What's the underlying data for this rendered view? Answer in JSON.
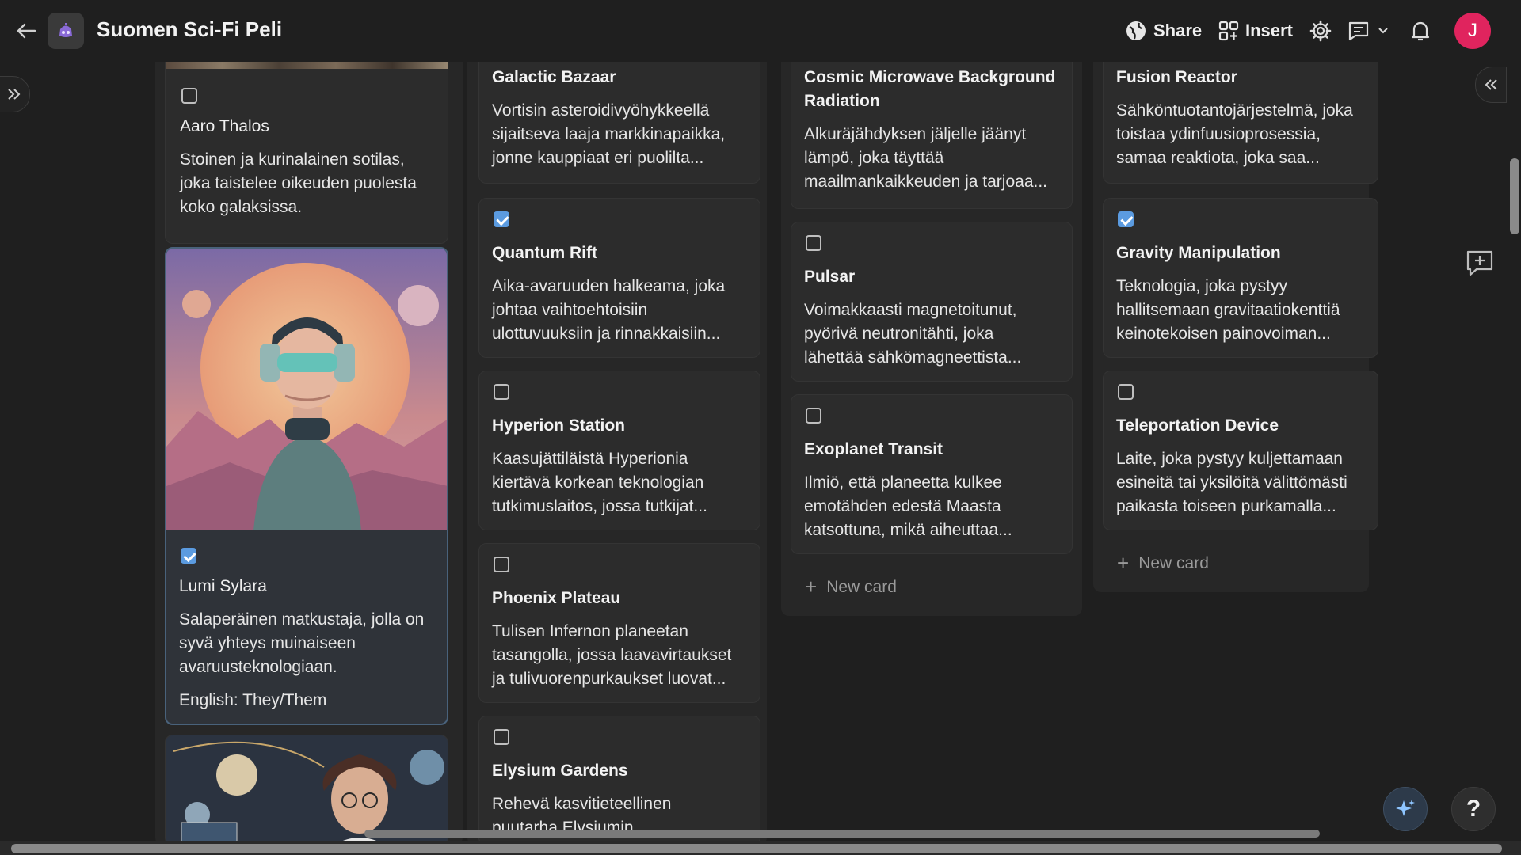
{
  "header": {
    "title": "Suomen Sci-Fi Peli",
    "share_label": "Share",
    "insert_label": "Insert",
    "avatar_initial": "J"
  },
  "colors": {
    "accent": "#5b9be0",
    "avatar": "#e0245e",
    "background": "#1f1f1f"
  },
  "columns": [
    {
      "cards": [
        {
          "checked": false,
          "name": "Aaro Thalos",
          "text": [
            "Stoinen ja kurinalainen sotilas,",
            "joka taistelee oikeuden puolesta",
            "koko galaksissa."
          ]
        },
        {
          "checked": true,
          "image": "astronaut-woman-illustration",
          "name": "Lumi Sylara",
          "text": [
            "Salaperäinen matkustaja, jolla on",
            "syvä yhteys muinaiseen",
            "avaruusteknologiaan."
          ],
          "extra": "English: They/Them"
        },
        {
          "image": "scientist-woman-illustration"
        }
      ]
    },
    {
      "cards": [
        {
          "title": "Galactic Bazaar",
          "text": [
            "Vortisin asteroidivyöhykkeellä",
            "sijaitseva laaja markkinapaikka,",
            "jonne kauppiaat eri puolilta..."
          ]
        },
        {
          "checked": true,
          "title": "Quantum Rift",
          "text": [
            "Aika-avaruuden halkeama, joka",
            "johtaa vaihtoehtoisiin",
            "ulottuvuuksiin ja rinnakkaisiin..."
          ]
        },
        {
          "checked": false,
          "title": "Hyperion Station",
          "text": [
            "Kaasujättiläistä Hyperionia",
            "kiertävä korkean teknologian",
            "tutkimuslaitos, jossa tutkijat..."
          ]
        },
        {
          "checked": false,
          "title": "Phoenix Plateau",
          "text": [
            "Tulisen Infernon planeetan",
            "tasangolla, jossa laavavirtaukset",
            "ja tulivuorenpurkaukset luovat..."
          ]
        },
        {
          "checked": false,
          "title": "Elysium Gardens",
          "text": [
            "Rehevä kasvitieteellinen",
            "puutarha Elysiumin"
          ]
        }
      ]
    },
    {
      "cards": [
        {
          "title": [
            "Cosmic Microwave Background",
            "Radiation"
          ],
          "text": [
            "Alkuräjähdyksen jäljelle jäänyt",
            "lämpö, joka täyttää",
            "maailmankaikkeuden ja tarjoaa..."
          ]
        },
        {
          "checked": false,
          "title": "Pulsar",
          "text": [
            "Voimakkaasti magnetoitunut,",
            "pyörivä neutronitähti, joka",
            "lähettää sähkömagneettista..."
          ]
        },
        {
          "checked": false,
          "title": "Exoplanet Transit",
          "text": [
            "Ilmiö, että planeetta kulkee",
            "emotähden edestä Maasta",
            "katsottuna, mikä aiheuttaa..."
          ]
        }
      ],
      "new_card_label": "New card"
    },
    {
      "cards": [
        {
          "title": "Fusion Reactor",
          "text": [
            "Sähköntuotantojärjestelmä, joka",
            "toistaa ydinfuusioprosessia,",
            "samaa reaktiota, joka saa..."
          ]
        },
        {
          "checked": true,
          "title": "Gravity Manipulation",
          "text": [
            "Teknologia, joka pystyy",
            "hallitsemaan gravitaatiokenttiä",
            "keinotekoisen painovoiman..."
          ]
        },
        {
          "checked": false,
          "title": "Teleportation Device",
          "text": [
            "Laite, joka pystyy kuljettamaan",
            "esineitä tai yksilöitä välittömästi",
            "paikasta toiseen purkamalla..."
          ]
        }
      ],
      "new_card_label": "New card"
    }
  ],
  "help_label": "?"
}
